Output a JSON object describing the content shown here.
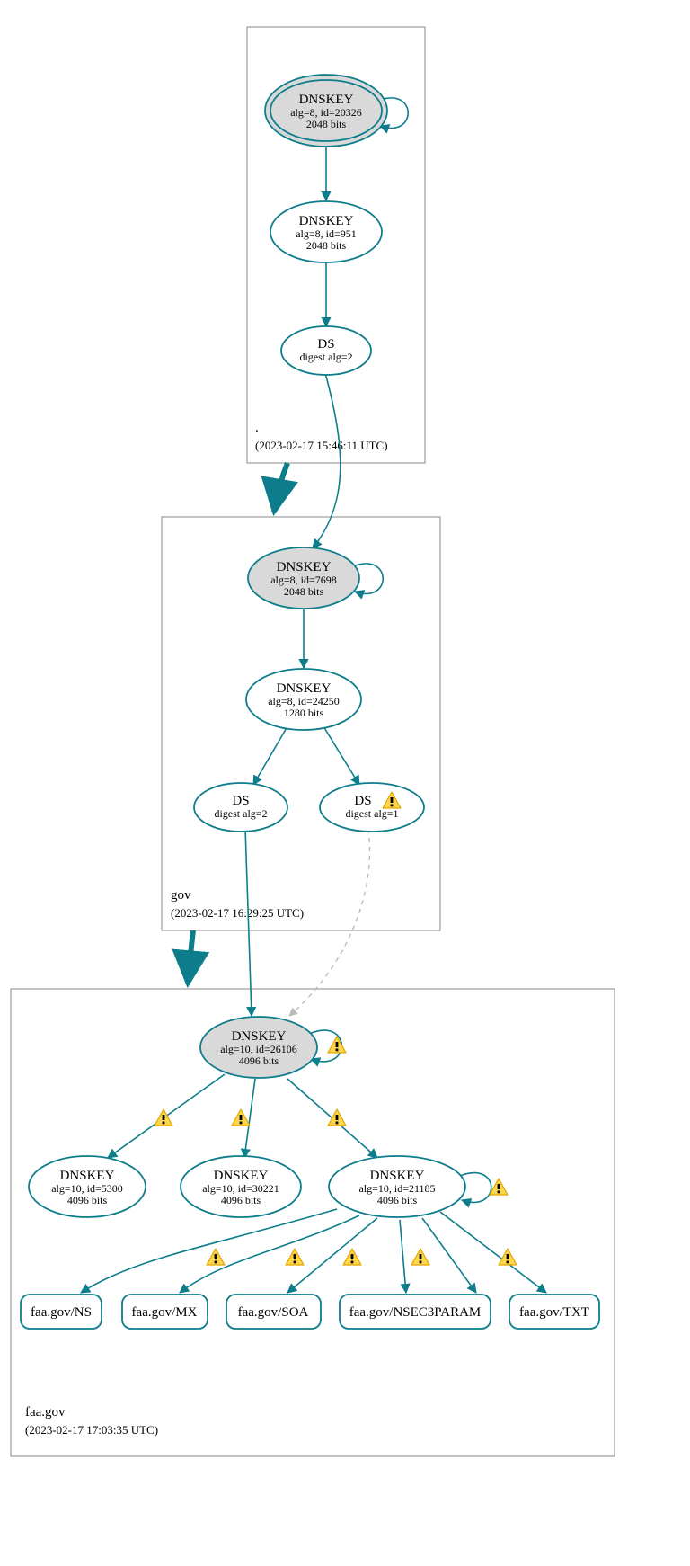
{
  "zones": {
    "root": {
      "label": ".",
      "timestamp": "(2023-02-17 15:46:11 UTC)"
    },
    "gov": {
      "label": "gov",
      "timestamp": "(2023-02-17 16:29:25 UTC)"
    },
    "faa": {
      "label": "faa.gov",
      "timestamp": "(2023-02-17 17:03:35 UTC)"
    }
  },
  "nodes": {
    "root_ksk": {
      "title": "DNSKEY",
      "line1": "alg=8, id=20326",
      "line2": "2048 bits"
    },
    "root_zsk": {
      "title": "DNSKEY",
      "line1": "alg=8, id=951",
      "line2": "2048 bits"
    },
    "root_ds": {
      "title": "DS",
      "line1": "digest alg=2"
    },
    "gov_ksk": {
      "title": "DNSKEY",
      "line1": "alg=8, id=7698",
      "line2": "2048 bits"
    },
    "gov_zsk": {
      "title": "DNSKEY",
      "line1": "alg=8, id=24250",
      "line2": "1280 bits"
    },
    "gov_ds2": {
      "title": "DS",
      "line1": "digest alg=2"
    },
    "gov_ds1": {
      "title": "DS",
      "line1": "digest alg=1"
    },
    "faa_ksk": {
      "title": "DNSKEY",
      "line1": "alg=10, id=26106",
      "line2": "4096 bits"
    },
    "faa_k1": {
      "title": "DNSKEY",
      "line1": "alg=10, id=5300",
      "line2": "4096 bits"
    },
    "faa_k2": {
      "title": "DNSKEY",
      "line1": "alg=10, id=30221",
      "line2": "4096 bits"
    },
    "faa_k3": {
      "title": "DNSKEY",
      "line1": "alg=10, id=21185",
      "line2": "4096 bits"
    },
    "rr_ns": {
      "label": "faa.gov/NS"
    },
    "rr_mx": {
      "label": "faa.gov/MX"
    },
    "rr_soa": {
      "label": "faa.gov/SOA"
    },
    "rr_nsec3": {
      "label": "faa.gov/NSEC3PARAM"
    },
    "rr_txt": {
      "label": "faa.gov/TXT"
    }
  }
}
